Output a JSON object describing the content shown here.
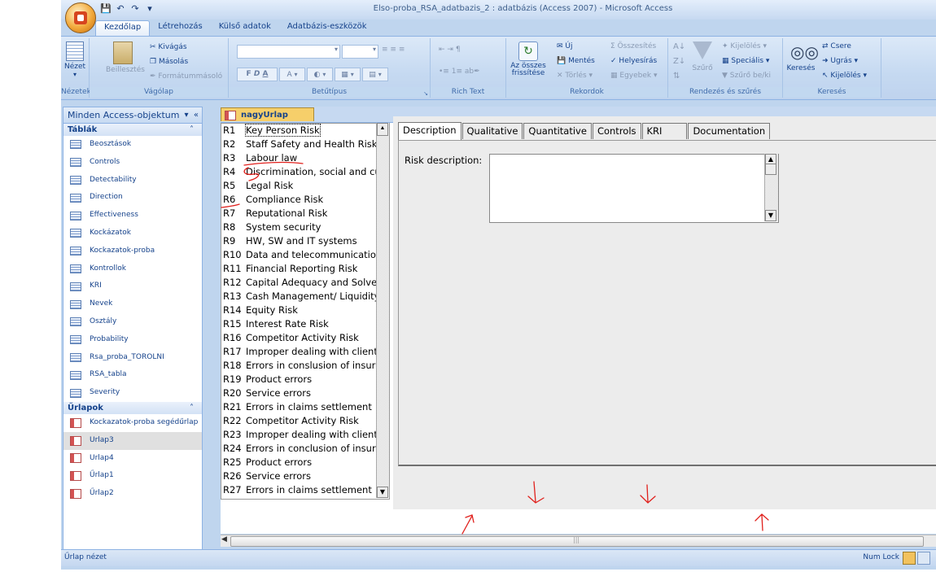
{
  "window": {
    "title": "Elso-proba_RSA_adatbazis_2 : adatbázis (Access 2007) - Microsoft Access"
  },
  "quick_access": [
    "save-icon",
    "undo-icon",
    "redo-icon",
    "customize-icon"
  ],
  "ribbon_tabs": [
    "Kezdőlap",
    "Létrehozás",
    "Külső adatok",
    "Adatbázis-eszközök"
  ],
  "ribbon": {
    "views": {
      "nezet": "Nézet",
      "label": "Nézetek"
    },
    "clipboard": {
      "beilleszt": "Beillesztés",
      "kivagas": "Kivágás",
      "masolas": "Másolás",
      "formatummasolo": "Formátummásoló",
      "label": "Vágólap"
    },
    "font": {
      "label": "Betűtípus",
      "bold": "F",
      "italic": "D",
      "underline": "A",
      "fontcolor": "A"
    },
    "richtext": {
      "label": "Rich Text"
    },
    "records": {
      "refresh": "Az összes frissítése",
      "uj": "Új",
      "mentes": "Mentés",
      "torles": "Törlés",
      "osszesites": "Összesítés",
      "helyesiras": "Helyesírás",
      "egyebek": "Egyebek",
      "label": "Rekordok"
    },
    "sortfilter": {
      "szuro": "Szűrő",
      "kijeloles": "Kijelölés",
      "specialis": "Speciális",
      "szuro_beki": "Szűrő be/ki",
      "label": "Rendezés és szűrés"
    },
    "find": {
      "kereses": "Keresés",
      "csere": "Csere",
      "ugras": "Ugrás",
      "kijeloles": "Kijelölés",
      "label": "Keresés"
    }
  },
  "nav": {
    "title": "Minden Access-objektum",
    "tables_header": "Táblák",
    "tables": [
      "Beosztások",
      "Controls",
      "Detectability",
      "Direction",
      "Effectiveness",
      "Kockázatok",
      "Kockazatok-proba",
      "Kontrollok",
      "KRI",
      "Nevek",
      "Osztály",
      "Probability",
      "Rsa_proba_TOROLNI",
      "RSA_tabla",
      "Severity"
    ],
    "forms_header": "Űrlapok",
    "forms": [
      "Kockazatok-proba segédűrlap",
      "Urlap3",
      "Urlap4",
      "Űrlap1",
      "Űrlap2"
    ],
    "selected_form": "Urlap3"
  },
  "document_tab": "nagyUrlap",
  "risk_list": [
    [
      "R1",
      "Key Person Risk"
    ],
    [
      "R2",
      "Staff Safety and Health Risk"
    ],
    [
      "R3",
      "Labour law"
    ],
    [
      "R4",
      "Discrimination, social and cul"
    ],
    [
      "R5",
      "Legal Risk"
    ],
    [
      "R6",
      "Compliance Risk"
    ],
    [
      "R7",
      "Reputational Risk"
    ],
    [
      "R8",
      "System security"
    ],
    [
      "R9",
      "HW, SW and IT systems"
    ],
    [
      "R10",
      "Data and telecommunication:"
    ],
    [
      "R11",
      "Financial Reporting Risk"
    ],
    [
      "R12",
      "Capital Adequacy and Solvenc"
    ],
    [
      "R13",
      "Cash Management/ Liquidity"
    ],
    [
      "R14",
      "Equity Risk"
    ],
    [
      "R15",
      "Interest Rate Risk"
    ],
    [
      "R16",
      "Competitor Activity Risk"
    ],
    [
      "R17",
      "Improper dealing with clients"
    ],
    [
      "R18",
      "Errors in conslusion of insurar"
    ],
    [
      "R19",
      "Product errors"
    ],
    [
      "R20",
      "Service errors"
    ],
    [
      "R21",
      "Errors in claims settlement"
    ],
    [
      "R22",
      "Competitor Activity Risk"
    ],
    [
      "R23",
      "Improper dealing with clients"
    ],
    [
      "R24",
      "Errors in conclusion of insurar"
    ],
    [
      "R25",
      "Product errors"
    ],
    [
      "R26",
      "Service errors"
    ],
    [
      "R27",
      "Errors in claims settlement"
    ]
  ],
  "form_tabs": [
    "Description",
    "Qualitative",
    "Quantitative",
    "Controls",
    "KRI",
    "Documentation"
  ],
  "active_form_tab": "Description",
  "risk_description_label": "Risk description:",
  "risk_description_value": "",
  "status": {
    "left": "Űrlap nézet",
    "numlock": "Num Lock"
  },
  "colors": {
    "ribbon": "#c5d9f1",
    "doc_tab": "#f6cf6a",
    "annotation": "#e0201c"
  }
}
